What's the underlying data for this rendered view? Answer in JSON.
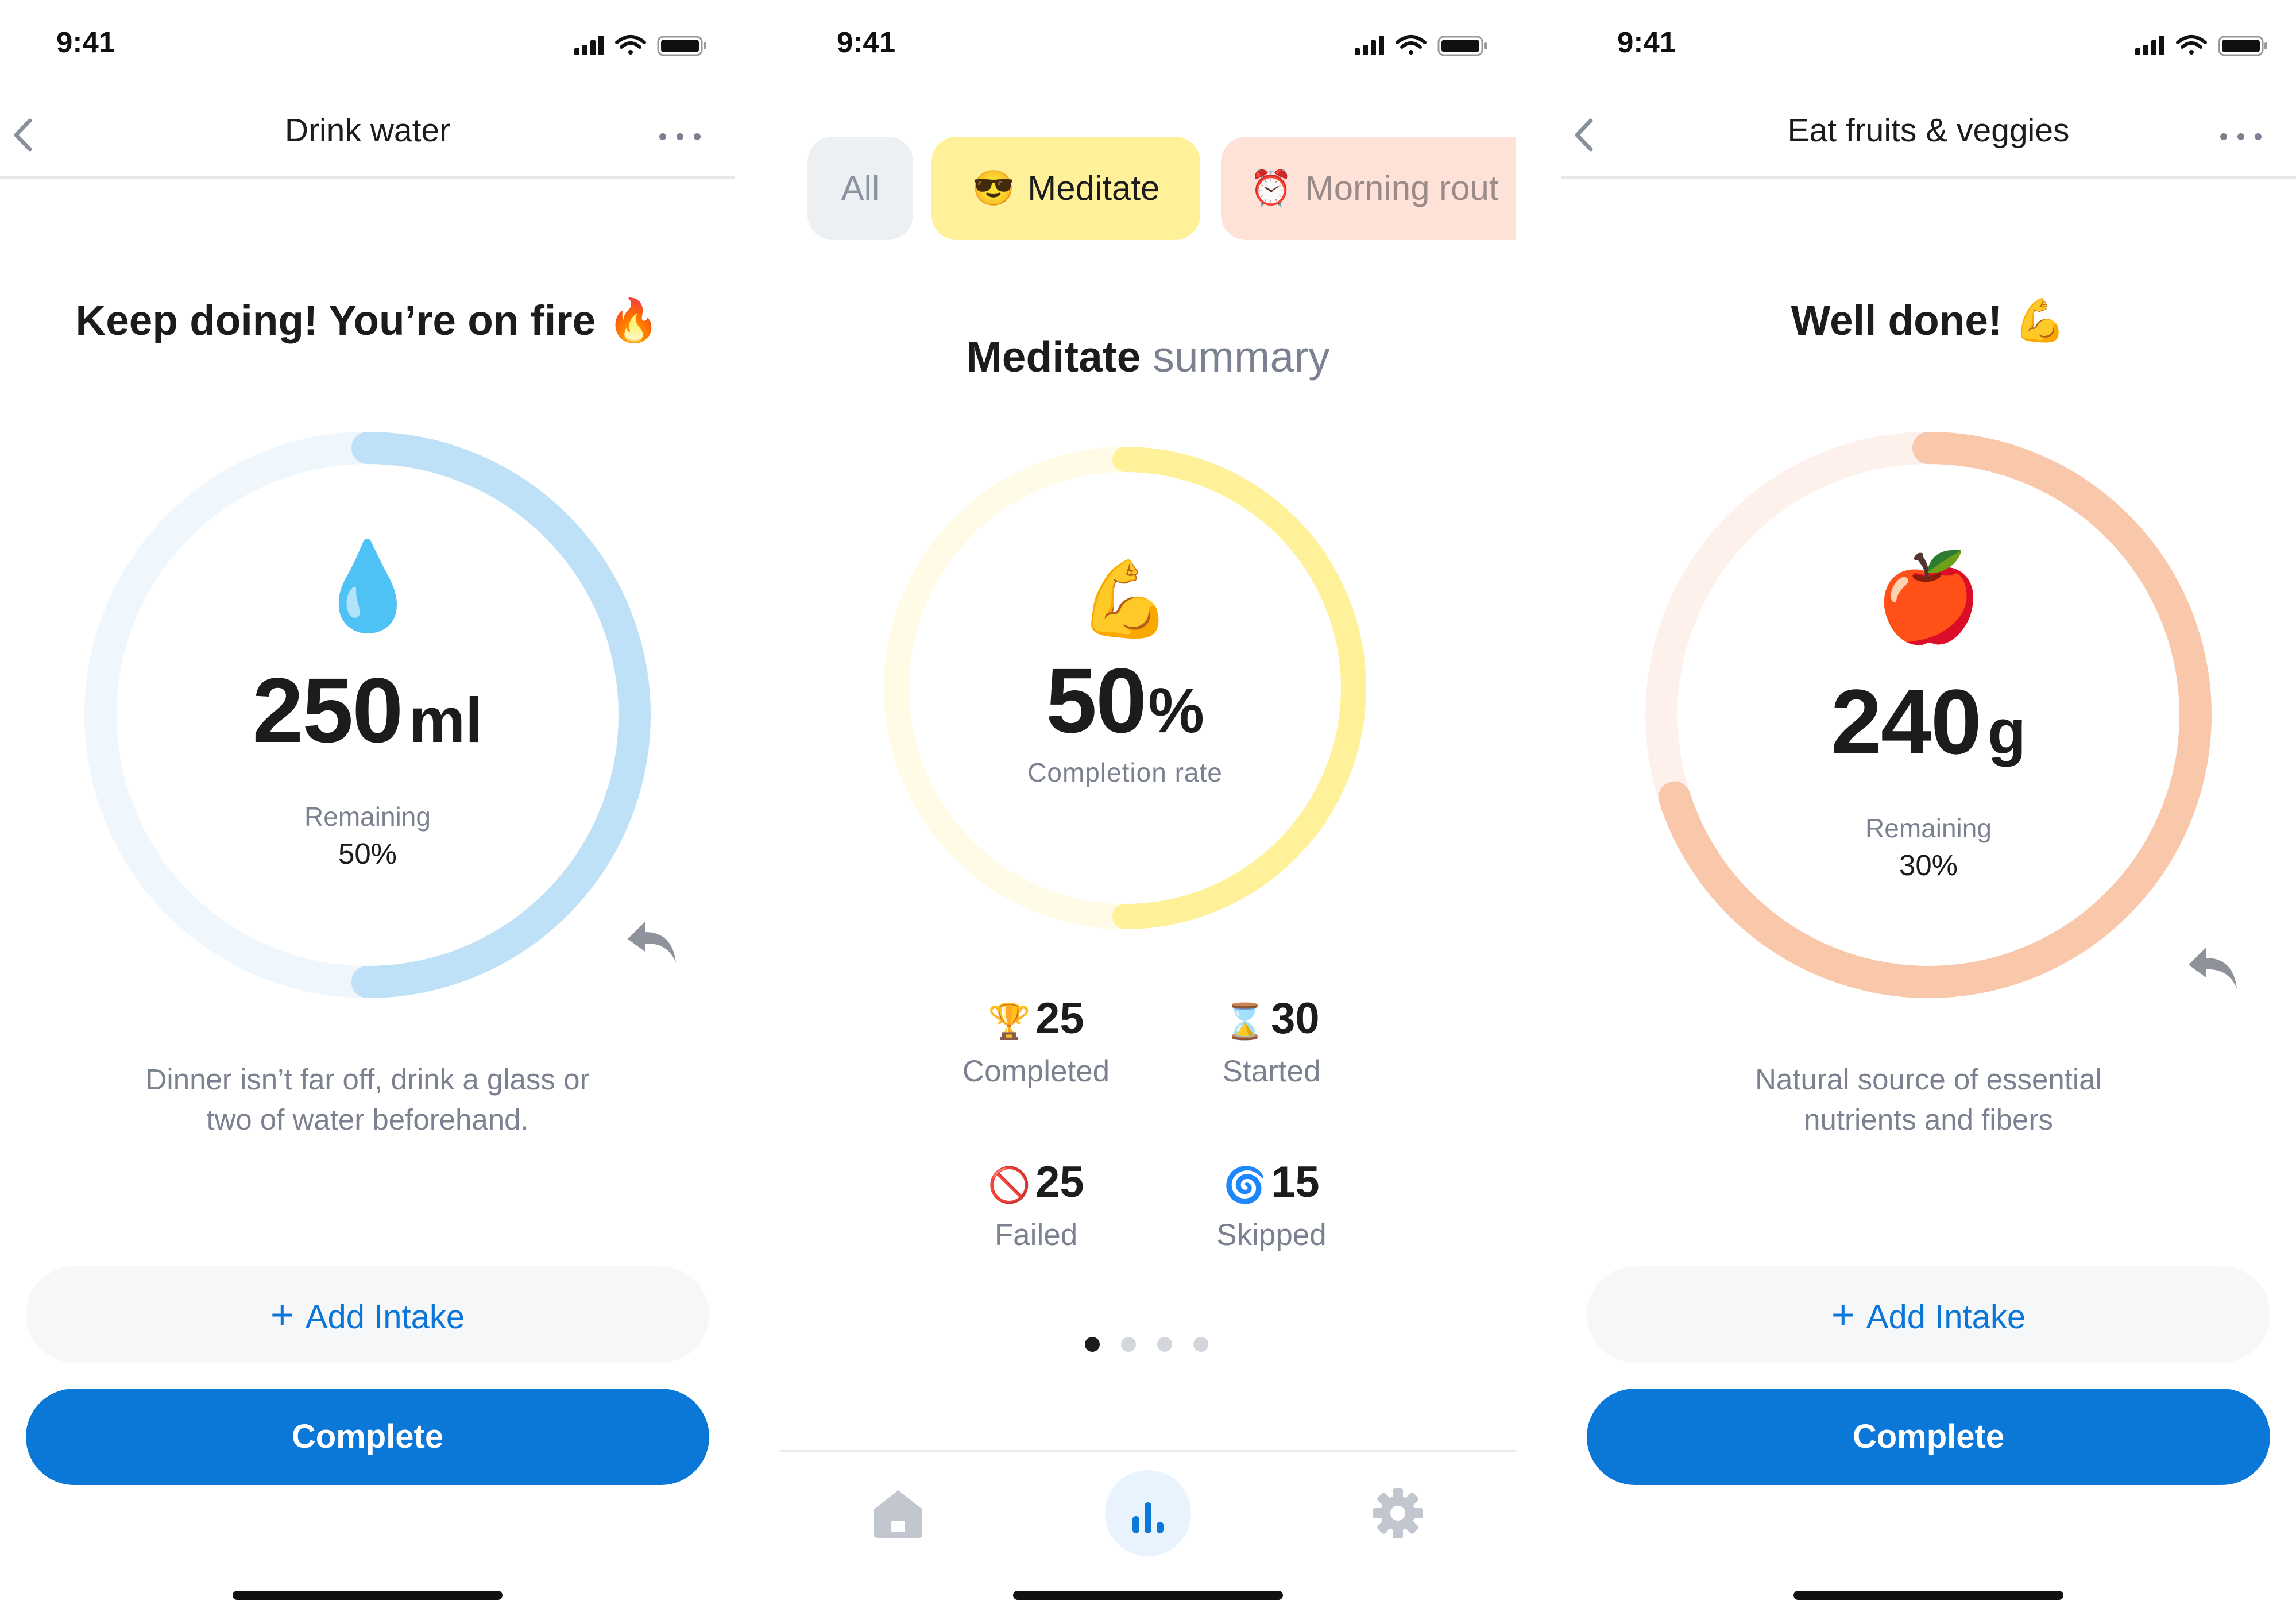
{
  "status_bar": {
    "time": "9:41"
  },
  "screen_drink": {
    "title": "Drink water",
    "headline": "Keep doing! You’re on fire",
    "headline_emoji": "🔥",
    "icon_emoji": "💧",
    "value": "250",
    "unit": "ml",
    "remaining_label": "Remaining",
    "remaining_percent": "50%",
    "progress_fraction": 0.5,
    "accent_color": "#bfe1f8",
    "track_color": "#eff7fd",
    "description": "Dinner isn’t far off, drink a glass or\ntwo of water beforehand.",
    "add_button": "Add Intake",
    "complete_button": "Complete"
  },
  "screen_summary": {
    "chips": [
      {
        "label": "All",
        "emoji": ""
      },
      {
        "label": "Meditate",
        "emoji": "😎"
      },
      {
        "label": "Morning rout",
        "emoji": "⏰"
      }
    ],
    "summary_habit": "Meditate",
    "summary_word": "summary",
    "icon_emoji": "💪",
    "value": "50",
    "unit": "%",
    "rate_label": "Completion rate",
    "progress_fraction": 0.5,
    "accent_color": "#fff09a",
    "track_color": "#fffbe6",
    "stats": [
      {
        "emoji": "🏆",
        "value": "25",
        "label": "Completed"
      },
      {
        "emoji": "⌛",
        "value": "30",
        "label": "Started"
      },
      {
        "emoji": "🚫",
        "value": "25",
        "label": "Failed"
      },
      {
        "emoji": "🌀",
        "value": "15",
        "label": "Skipped"
      }
    ],
    "page_dots": {
      "count": 4,
      "active": 0
    },
    "tabs": [
      "home-icon",
      "stats-icon",
      "settings-icon"
    ],
    "active_tab": 1
  },
  "screen_fruits": {
    "title": "Eat fruits & veggies",
    "headline": "Well done!",
    "headline_emoji": "💪",
    "icon_emoji": "🍎",
    "value": "240",
    "unit": "g",
    "remaining_label": "Remaining",
    "remaining_percent": "30%",
    "progress_fraction": 0.7,
    "accent_color": "#f9c7aa",
    "track_color": "#fef1ec",
    "description": "Natural source of essential\nnutrients and fibers",
    "add_button": "Add Intake",
    "complete_button": "Complete"
  },
  "colors": {
    "primary": "#0b78d7",
    "secondary_text": "#7b8190"
  }
}
